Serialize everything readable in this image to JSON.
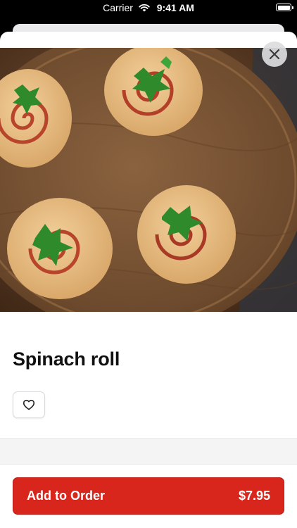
{
  "status_bar": {
    "carrier": "Carrier",
    "time": "9:41 AM"
  },
  "product": {
    "name": "Spinach roll",
    "image_alt": "Pinwheel rolls with parsley on a wooden board"
  },
  "actions": {
    "add_to_order_label": "Add to Order",
    "price": "$7.95"
  },
  "icons": {
    "close": "close-icon",
    "favorite": "heart-icon",
    "wifi": "wifi-icon",
    "battery": "battery-icon"
  },
  "colors": {
    "primary": "#d8261c",
    "text": "#111111"
  }
}
